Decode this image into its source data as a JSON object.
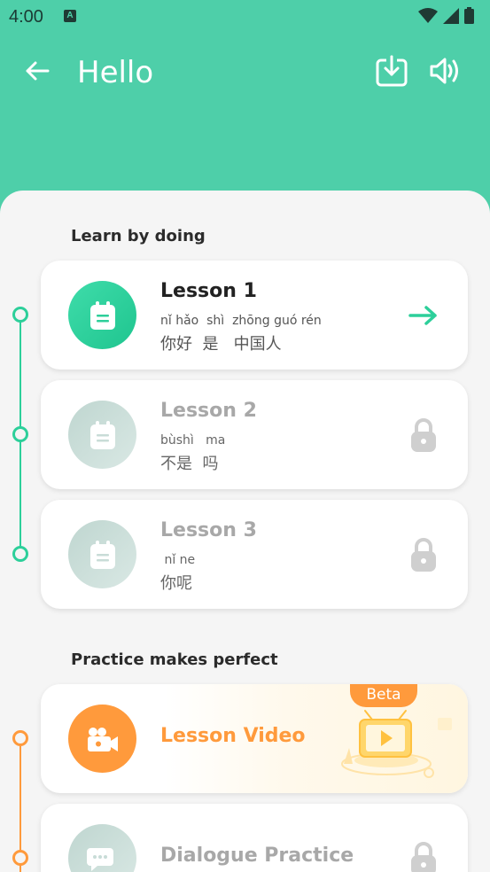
{
  "status": {
    "time": "4:00",
    "notif_letter": "A"
  },
  "header": {
    "title": "Hello"
  },
  "sections": {
    "learn": "Learn by doing",
    "practice": "Practice makes perfect"
  },
  "lessons": [
    {
      "title": "Lesson 1",
      "pinyin": "nǐ hǎo  shì  zhōng guó rén",
      "hanzi": "你好  是   中国人",
      "state": "active"
    },
    {
      "title": "Lesson 2",
      "pinyin": "bùshì   ma",
      "hanzi": "不是  吗",
      "state": "locked"
    },
    {
      "title": "Lesson 3",
      "pinyin": " nǐ ne",
      "hanzi": "你呢",
      "state": "locked"
    }
  ],
  "practice": [
    {
      "title": "Lesson Video",
      "badge": "Beta",
      "state": "active"
    },
    {
      "title": "Dialogue Practice",
      "state": "locked"
    }
  ],
  "colors": {
    "header_bg": "#4ecfa9",
    "green_accent": "#2dcf9a",
    "orange_accent": "#ff9a3c",
    "locked_circle": "#cfe0dc",
    "lock_gray": "#cfcfcf"
  }
}
